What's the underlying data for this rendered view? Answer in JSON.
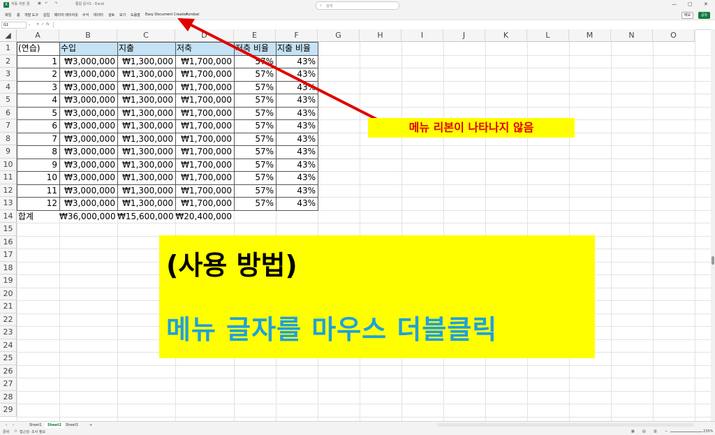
{
  "title_bar": {
    "autosave_label": "자동 저장",
    "autosave_state": "끔",
    "doc_title": "통합 문서1 - Excel",
    "search_placeholder": "검색"
  },
  "menu": {
    "items": [
      "파일",
      "홈",
      "개발 도구",
      "삽입",
      "페이지 레이아웃",
      "수식",
      "데이터",
      "검토",
      "보기",
      "도움말",
      "Easy Document Creator",
      "Acrobat"
    ],
    "comments_label": "메모",
    "share_label": "공유"
  },
  "formula_bar": {
    "name_box": "G1",
    "fx": "fx"
  },
  "columns": [
    "A",
    "B",
    "C",
    "D",
    "E",
    "F",
    "G",
    "H",
    "I",
    "J",
    "K",
    "L",
    "M",
    "N",
    "O"
  ],
  "rows": [
    "1",
    "2",
    "3",
    "4",
    "5",
    "6",
    "7",
    "8",
    "9",
    "10",
    "11",
    "12",
    "13",
    "14",
    "15",
    "16",
    "17",
    "18",
    "19",
    "20",
    "21",
    "22",
    "23",
    "24",
    "25",
    "26",
    "27",
    "28",
    "29"
  ],
  "table": {
    "headers": [
      "(연습)",
      "수입",
      "지출",
      "저축",
      "저축 비율",
      "지출 비율"
    ],
    "data": [
      [
        "1",
        "₩3,000,000",
        "₩1,300,000",
        "₩1,700,000",
        "57%",
        "43%"
      ],
      [
        "2",
        "₩3,000,000",
        "₩1,300,000",
        "₩1,700,000",
        "57%",
        "43%"
      ],
      [
        "3",
        "₩3,000,000",
        "₩1,300,000",
        "₩1,700,000",
        "57%",
        "43%"
      ],
      [
        "4",
        "₩3,000,000",
        "₩1,300,000",
        "₩1,700,000",
        "57%",
        "43%"
      ],
      [
        "5",
        "₩3,000,000",
        "₩1,300,000",
        "₩1,700,000",
        "57%",
        "43%"
      ],
      [
        "6",
        "₩3,000,000",
        "₩1,300,000",
        "₩1,700,000",
        "57%",
        "43%"
      ],
      [
        "7",
        "₩3,000,000",
        "₩1,300,000",
        "₩1,700,000",
        "57%",
        "43%"
      ],
      [
        "8",
        "₩3,000,000",
        "₩1,300,000",
        "₩1,700,000",
        "57%",
        "43%"
      ],
      [
        "9",
        "₩3,000,000",
        "₩1,300,000",
        "₩1,700,000",
        "57%",
        "43%"
      ],
      [
        "10",
        "₩3,000,000",
        "₩1,300,000",
        "₩1,700,000",
        "57%",
        "43%"
      ],
      [
        "11",
        "₩3,000,000",
        "₩1,300,000",
        "₩1,700,000",
        "57%",
        "43%"
      ],
      [
        "12",
        "₩3,000,000",
        "₩1,300,000",
        "₩1,700,000",
        "57%",
        "43%"
      ]
    ],
    "total": [
      "합계",
      "₩36,000,000",
      "₩15,600,000",
      "₩20,400,000"
    ]
  },
  "annotation": {
    "callout": "메뉴 리본이 나타나지 않음",
    "instruction_title": "(사용 방법)",
    "instruction_body": "메뉴 글자를 마우스 더블클릭"
  },
  "sheets": [
    "Sheet1",
    "Sheet2",
    "Sheet3"
  ],
  "active_sheet": "Sheet2",
  "status": {
    "ready": "준비",
    "accessibility": "접근성: 조사 필요",
    "zoom": "235%"
  },
  "colors": {
    "header_fill": "#c5e3f5",
    "highlight": "#ffff00",
    "arrow": "#e00000",
    "instruction_text": "#1ea0dc",
    "excel_green": "#107c41"
  }
}
